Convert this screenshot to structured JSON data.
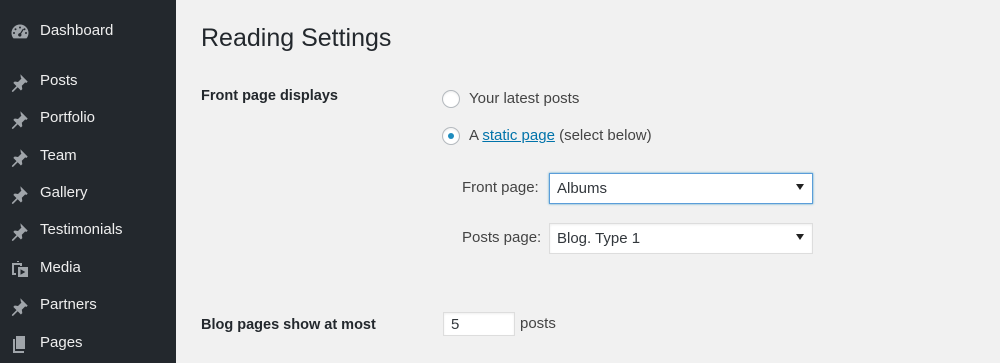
{
  "sidebar": {
    "items": [
      {
        "label": "Dashboard",
        "icon": "dashboard-icon"
      },
      {
        "label": "Posts",
        "icon": "pushpin-icon"
      },
      {
        "label": "Portfolio",
        "icon": "pushpin-icon"
      },
      {
        "label": "Team",
        "icon": "pushpin-icon"
      },
      {
        "label": "Gallery",
        "icon": "pushpin-icon"
      },
      {
        "label": "Testimonials",
        "icon": "pushpin-icon"
      },
      {
        "label": "Media",
        "icon": "media-icon"
      },
      {
        "label": "Partners",
        "icon": "pushpin-icon"
      },
      {
        "label": "Pages",
        "icon": "pages-icon"
      }
    ]
  },
  "page": {
    "title": "Reading Settings"
  },
  "front_page_displays": {
    "label": "Front page displays",
    "option_latest": "Your latest posts",
    "option_static_prefix": "A",
    "option_static_link": "static page",
    "option_static_suffix": "(select below)",
    "selected": "static",
    "front_page_label": "Front page:",
    "front_page_value": "Albums",
    "posts_page_label": "Posts page:",
    "posts_page_value": "Blog. Type 1"
  },
  "blog_pages": {
    "label": "Blog pages show at most",
    "value": "5",
    "suffix": "posts"
  },
  "colors": {
    "sidebar_bg": "#23282d",
    "content_bg": "#f1f1f1",
    "accent": "#0073aa",
    "radio_dot": "#1e8cbe"
  }
}
